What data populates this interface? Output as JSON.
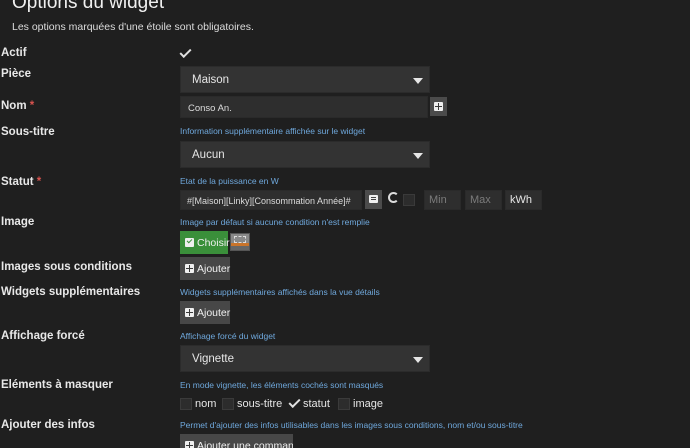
{
  "header": {
    "title": "Options du widget",
    "subtitle": "Les options marquées d'une étoile sont obligatoires."
  },
  "fields": {
    "actif": {
      "label": "Actif"
    },
    "piece": {
      "label": "Pièce",
      "value": "Maison"
    },
    "nom": {
      "label": "Nom",
      "required": "*",
      "value": "Conso An."
    },
    "sous_titre": {
      "label": "Sous-titre",
      "help": "Information supplémentaire affichée sur le widget",
      "value": "Aucun"
    },
    "statut": {
      "label": "Statut",
      "required": "*",
      "help": "Etat de la puissance en W",
      "value": "#[Maison][Linky][Consommation Année]#",
      "min_placeholder": "Min",
      "max_placeholder": "Max",
      "unit": "kWh"
    },
    "image": {
      "label": "Image",
      "help": "Image par défaut si aucune condition n'est remplie",
      "button": "Choisir"
    },
    "images_conditions": {
      "label": "Images sous conditions",
      "button": "Ajouter"
    },
    "widgets_supp": {
      "label": "Widgets supplémentaires",
      "help": "Widgets supplémentaires affichés dans la vue détails",
      "button": "Ajouter"
    },
    "affichage_force": {
      "label": "Affichage forcé",
      "help": "Affichage forcé du widget",
      "value": "Vignette"
    },
    "elements_masquer": {
      "label": "Eléments à masquer",
      "help": "En mode vignette, les éléments cochés sont masqués",
      "options": [
        {
          "label": "nom",
          "checked": false
        },
        {
          "label": "sous-titre",
          "checked": false
        },
        {
          "label": "statut",
          "checked": true
        },
        {
          "label": "image",
          "checked": false
        }
      ]
    },
    "ajouter_infos": {
      "label": "Ajouter des infos",
      "help": "Permet d'ajouter des infos utilisables dans les images sous conditions, nom et/ou sous-titre",
      "button": "Ajouter une commande"
    }
  },
  "colors": {
    "help_text": "#6fa8dc",
    "required_star": "#d9534f",
    "choose_button": "#3a8f3a"
  },
  "icons": {
    "list": "list-icon",
    "refresh": "refresh-icon",
    "add": "plus-square-icon",
    "check": "check-icon",
    "caret": "caret-down-icon"
  }
}
